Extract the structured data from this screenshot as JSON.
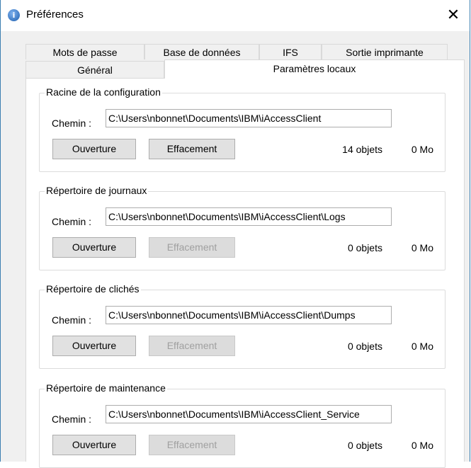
{
  "window": {
    "title": "Préférences",
    "close_glyph": "✕",
    "app_icon_glyph": "i"
  },
  "tabs_row1": [
    {
      "label": "Mots de passe"
    },
    {
      "label": "Base de données"
    },
    {
      "label": "IFS"
    },
    {
      "label": "Sortie imprimante"
    }
  ],
  "tabs_row2": [
    {
      "label": "Général"
    },
    {
      "label": "Paramètres locaux",
      "active": true
    }
  ],
  "groups": [
    {
      "title": "Racine de la configuration",
      "path_label": "Chemin :",
      "path": "C:\\Users\\nbonnet\\Documents\\IBM\\iAccessClient",
      "open_label": "Ouverture",
      "clear_label": "Effacement",
      "clear_enabled": true,
      "count": "14 objets",
      "size": "0 Mo"
    },
    {
      "title": "Répertoire de journaux",
      "path_label": "Chemin :",
      "path": "C:\\Users\\nbonnet\\Documents\\IBM\\iAccessClient\\Logs",
      "open_label": "Ouverture",
      "clear_label": "Effacement",
      "clear_enabled": false,
      "count": "0 objets",
      "size": "0 Mo"
    },
    {
      "title": "Répertoire de clichés",
      "path_label": "Chemin :",
      "path": "C:\\Users\\nbonnet\\Documents\\IBM\\iAccessClient\\Dumps",
      "open_label": "Ouverture",
      "clear_label": "Effacement",
      "clear_enabled": false,
      "count": "0 objets",
      "size": "0 Mo"
    },
    {
      "title": "Répertoire de maintenance",
      "path_label": "Chemin :",
      "path": "C:\\Users\\nbonnet\\Documents\\IBM\\iAccessClient_Service",
      "open_label": "Ouverture",
      "clear_label": "Effacement",
      "clear_enabled": false,
      "count": "0 objets",
      "size": "0 Mo"
    }
  ]
}
